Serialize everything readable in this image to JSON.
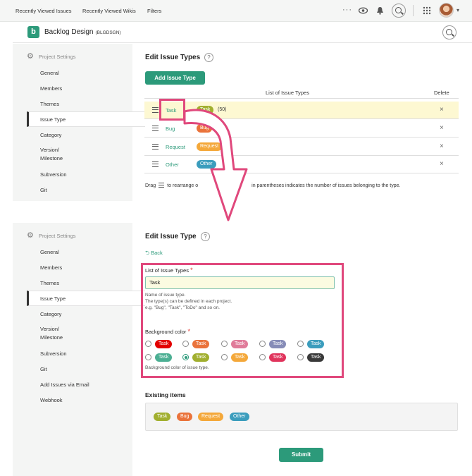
{
  "topnav": {
    "links": [
      "Recently Viewed Issues",
      "Recently Viewed Wikis",
      "Filters"
    ],
    "icons": [
      "more-icon",
      "eye-icon",
      "bell-icon",
      "search-icon",
      "apps-icon",
      "avatar",
      "chevron-down-icon"
    ]
  },
  "project": {
    "logo_letter": "b",
    "name": "Backlog Design",
    "key": "(BLGDSGN)"
  },
  "sidebar1": {
    "title": "Project Settings",
    "items": [
      "General",
      "Members",
      "Themes",
      "Issue Type",
      "Category",
      "Version/",
      "Milestone",
      "Subversion",
      "Git"
    ]
  },
  "sidebar2": {
    "title": "Project Settings",
    "items": [
      "General",
      "Members",
      "Themes",
      "Issue Type",
      "Category",
      "Version/",
      "Milestone",
      "Subversion",
      "Git",
      "Add Issues via Email",
      "Webhook"
    ]
  },
  "list_panel": {
    "title": "Edit Issue Types",
    "help": "?",
    "add_button": "Add Issue Type",
    "col_list": "List of Issue Types",
    "col_delete": "Delete",
    "rows": [
      {
        "name": "Task",
        "badge": "Task",
        "color": "#a1af2f",
        "count": "(50)"
      },
      {
        "name": "Bug",
        "badge": "Bug",
        "color": "#ea733b"
      },
      {
        "name": "Request",
        "badge": "Request",
        "color": "#f4a83a"
      },
      {
        "name": "Other",
        "badge": "Other",
        "color": "#3b9dbd"
      }
    ],
    "delete_glyph": "×",
    "drag_note_a": "Drag",
    "drag_note_b": "to rearrange o",
    "drag_note_c": "in parentheses indicates the number of issues belonging to the type."
  },
  "edit_panel": {
    "title": "Edit Issue Type",
    "help": "?",
    "back": "Back",
    "field_label": "List of Issue Types",
    "required": "*",
    "value": "Task",
    "hint_lines": [
      "Name of issue type.",
      "The type(s) can be defined in each project.",
      "e.g. \"Bug\", \"Task\", \"ToDo\" and so on."
    ],
    "bg_label": "Background color",
    "badge_text": "Task",
    "colors_row1": [
      "#e30000",
      "#ea733b",
      "#e07b9a",
      "#868cb7",
      "#3b9dbd"
    ],
    "colors_row2": [
      "#4caf93",
      "#a1af2f",
      "#f4a83a",
      "#e0345c",
      "#393939"
    ],
    "selected_index": 6,
    "bg_hint": "Background color of issue type.",
    "existing_title": "Existing items",
    "existing": [
      {
        "label": "Task",
        "color": "#a1af2f"
      },
      {
        "label": "Bug",
        "color": "#ea733b"
      },
      {
        "label": "Request",
        "color": "#f4a83a"
      },
      {
        "label": "Other",
        "color": "#3b9dbd"
      }
    ],
    "submit": "Submit"
  }
}
